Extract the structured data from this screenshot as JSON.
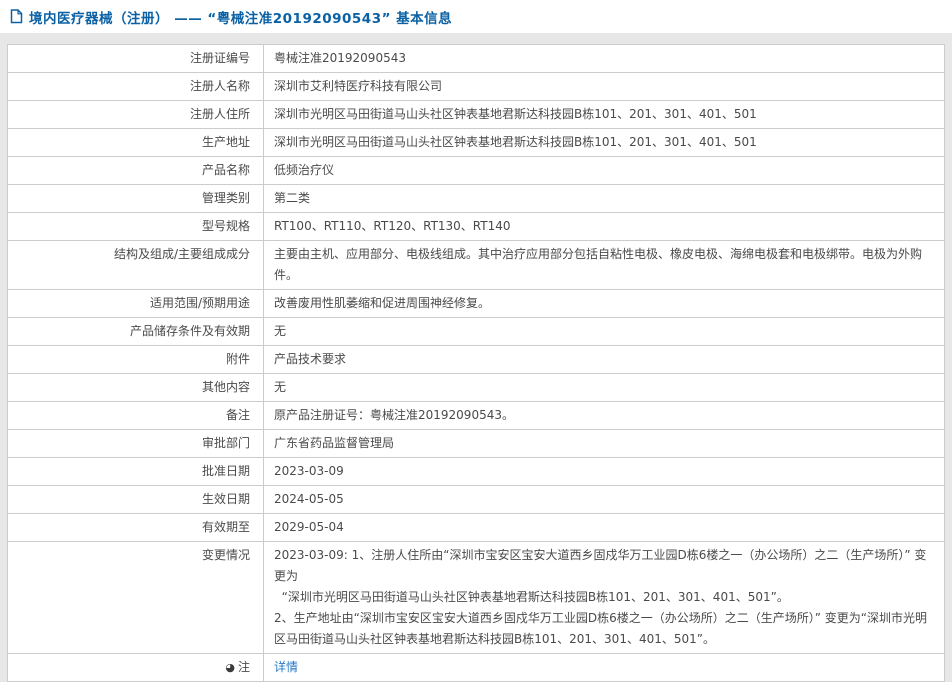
{
  "header": {
    "title": "境内医疗器械（注册） —— “粤械注准20192090543” 基本信息"
  },
  "colors": {
    "header_blue": "#0b61a4",
    "link_blue": "#2679c9",
    "border": "#cccccc",
    "page_bg": "#e7e7e7"
  },
  "table": {
    "rows": [
      {
        "label": "注册证编号",
        "value": "粤械注准20192090543"
      },
      {
        "label": "注册人名称",
        "value": "深圳市艾利特医疗科技有限公司"
      },
      {
        "label": "注册人住所",
        "value": "深圳市光明区马田街道马山头社区钟表基地君斯达科技园B栋101、201、301、401、501"
      },
      {
        "label": "生产地址",
        "value": "深圳市光明区马田街道马山头社区钟表基地君斯达科技园B栋101、201、301、401、501"
      },
      {
        "label": "产品名称",
        "value": "低频治疗仪"
      },
      {
        "label": "管理类别",
        "value": "第二类"
      },
      {
        "label": "型号规格",
        "value": "RT100、RT110、RT120、RT130、RT140"
      },
      {
        "label": "结构及组成/主要组成成分",
        "value": "主要由主机、应用部分、电极线组成。其中治疗应用部分包括自粘性电极、橡皮电极、海绵电极套和电极绑带。电极为外购件。"
      },
      {
        "label": "适用范围/预期用途",
        "value": "改善废用性肌萎缩和促进周围神经修复。"
      },
      {
        "label": "产品储存条件及有效期",
        "value": "无"
      },
      {
        "label": "附件",
        "value": "产品技术要求"
      },
      {
        "label": "其他内容",
        "value": "无"
      },
      {
        "label": "备注",
        "value": "原产品注册证号：粤械注准20192090543。"
      },
      {
        "label": "审批部门",
        "value": "广东省药品监督管理局"
      },
      {
        "label": "批准日期",
        "value": "2023-03-09"
      },
      {
        "label": "生效日期",
        "value": "2024-05-05"
      },
      {
        "label": "有效期至",
        "value": "2029-05-04"
      },
      {
        "label": "变更情况",
        "value": "2023-03-09: 1、注册人住所由“深圳市宝安区宝安大道西乡固戍华万工业园D栋6楼之一（办公场所）之二（生产场所）” 变更为\n  “深圳市光明区马田街道马山头社区钟表基地君斯达科技园B栋101、201、301、401、501”。\n2、生产地址由“深圳市宝安区宝安大道西乡固戍华万工业园D栋6楼之一（办公场所）之二（生产场所）” 变更为“深圳市光明区马田街道马山头社区钟表基地君斯达科技园B栋101、201、301、401、501”。"
      },
      {
        "label": "注",
        "label_icon": true,
        "value": "详情",
        "link": true
      }
    ]
  }
}
